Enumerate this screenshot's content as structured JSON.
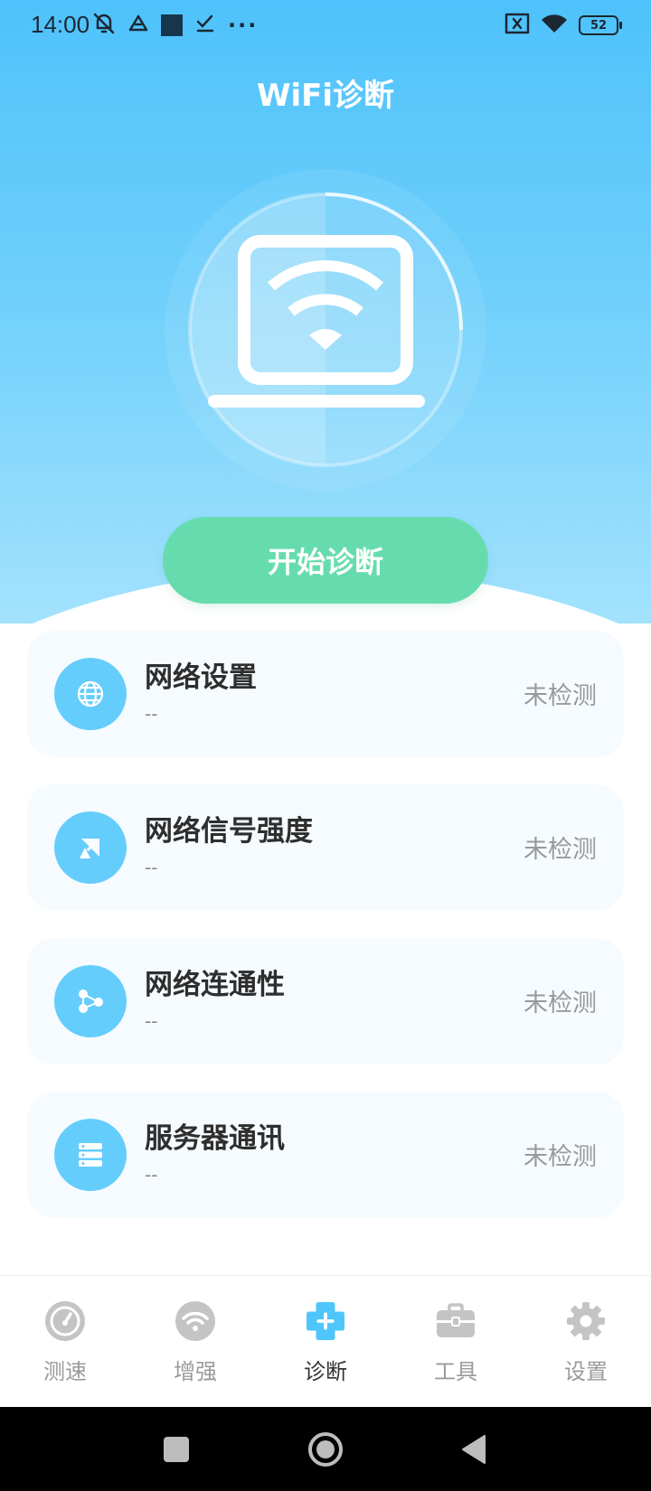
{
  "status_bar": {
    "time": "14:00",
    "battery": "52",
    "left_icons": [
      "mute-icon",
      "drive-icon",
      "square-icon",
      "check-icon",
      "more-dots-icon"
    ],
    "right_icons": [
      "sim-off-icon",
      "wifi-icon",
      "battery-icon"
    ]
  },
  "header": {
    "title": "WiFi诊断"
  },
  "hero": {
    "illustration": "laptop-wifi-icon",
    "start_label": "开始诊断"
  },
  "diagnostics": [
    {
      "title": "网络设置",
      "detail": "--",
      "status": "未检测",
      "icon": "globe-icon"
    },
    {
      "title": "网络信号强度",
      "detail": "--",
      "status": "未检测",
      "icon": "satellite-dish-icon"
    },
    {
      "title": "网络连通性",
      "detail": "--",
      "status": "未检测",
      "icon": "share-nodes-icon"
    },
    {
      "title": "服务器通讯",
      "detail": "--",
      "status": "未检测",
      "icon": "server-icon"
    }
  ],
  "tabs": [
    {
      "label": "测速",
      "icon": "speedometer-icon",
      "active": false
    },
    {
      "label": "增强",
      "icon": "wifi-boost-icon",
      "active": false
    },
    {
      "label": "诊断",
      "icon": "diagnose-icon",
      "active": true
    },
    {
      "label": "工具",
      "icon": "toolbox-icon",
      "active": false
    },
    {
      "label": "设置",
      "icon": "gear-icon",
      "active": false
    }
  ],
  "colors": {
    "hero_gradient_top": "#4ec2fb",
    "hero_gradient_bottom": "#a3e2fd",
    "start_button": "#66dcae",
    "card_icon_bg": "#65cdfb",
    "card_bg": "#f6fbff",
    "tab_active": "#4ec6fb",
    "tab_inactive": "#c4c4c4"
  }
}
